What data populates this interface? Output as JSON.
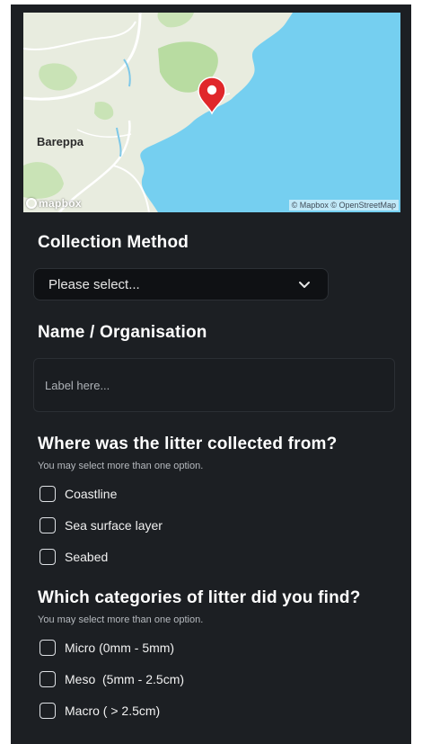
{
  "map": {
    "place_label": "Bareppa",
    "logo_text": "mapbox",
    "attribution": "© Mapbox © OpenStreetMap",
    "pin_icon": "map-pin-icon",
    "colors": {
      "sea": "#75cff0",
      "land": "#e8ecdf",
      "park": "#b8dca1",
      "pin": "#e0272b"
    }
  },
  "collection_method": {
    "title": "Collection Method",
    "selected_value": "Please select...",
    "chevron_icon": "chevron-down-icon"
  },
  "name_org": {
    "title": "Name / Organisation",
    "placeholder": "Label here..."
  },
  "location_question": {
    "title": "Where was the litter collected from?",
    "hint": "You may select more than one option.",
    "options": [
      {
        "label": "Coastline",
        "checked": false
      },
      {
        "label": "Sea surface layer",
        "checked": false
      },
      {
        "label": "Seabed",
        "checked": false
      }
    ]
  },
  "category_question": {
    "title": "Which categories of litter did you find?",
    "hint": "You may select more than one option.",
    "options": [
      {
        "label": "Micro (0mm - 5mm)",
        "checked": false
      },
      {
        "label": "Meso  (5mm - 2.5cm)",
        "checked": false
      },
      {
        "label": "Macro ( > 2.5cm)",
        "checked": false
      }
    ]
  },
  "theme": {
    "panel_bg": "#1c1f23",
    "text": "#ffffff"
  }
}
